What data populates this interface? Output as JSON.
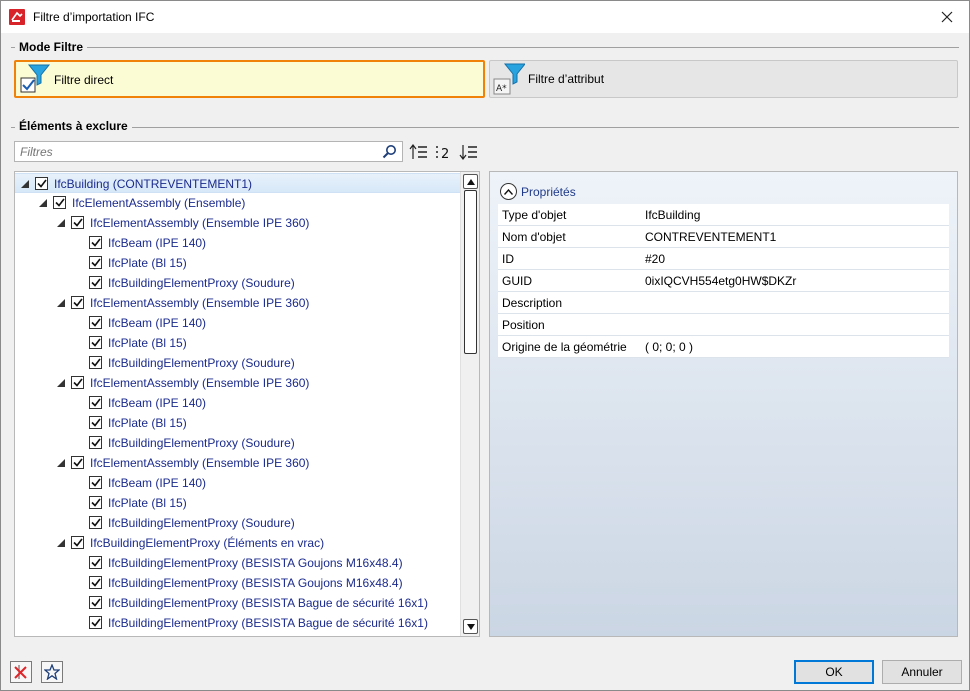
{
  "window": {
    "title": "Filtre d’importation IFC"
  },
  "mode_filter": {
    "heading": "Mode Filtre",
    "direct_label": "Filtre direct",
    "attribute_label": "Filtre d’attribut",
    "active": "direct"
  },
  "exclude": {
    "heading": "Éléments à exclure",
    "filter_placeholder": "Filtres",
    "filter_value": ""
  },
  "tree": [
    {
      "label": "IfcBuilding (CONTREVENTEMENT1)",
      "level": 0,
      "expandable": true,
      "checked": true,
      "selected": true
    },
    {
      "label": "IfcElementAssembly (Ensemble)",
      "level": 1,
      "expandable": true,
      "checked": true
    },
    {
      "label": "IfcElementAssembly (Ensemble IPE 360)",
      "level": 2,
      "expandable": true,
      "checked": true
    },
    {
      "label": "IfcBeam (IPE 140)",
      "level": 3,
      "expandable": false,
      "checked": true
    },
    {
      "label": "IfcPlate (Bl 15)",
      "level": 3,
      "expandable": false,
      "checked": true
    },
    {
      "label": "IfcBuildingElementProxy (Soudure)",
      "level": 3,
      "expandable": false,
      "checked": true
    },
    {
      "label": "IfcElementAssembly (Ensemble IPE 360)",
      "level": 2,
      "expandable": true,
      "checked": true
    },
    {
      "label": "IfcBeam (IPE 140)",
      "level": 3,
      "expandable": false,
      "checked": true
    },
    {
      "label": "IfcPlate (Bl 15)",
      "level": 3,
      "expandable": false,
      "checked": true
    },
    {
      "label": "IfcBuildingElementProxy (Soudure)",
      "level": 3,
      "expandable": false,
      "checked": true
    },
    {
      "label": "IfcElementAssembly (Ensemble IPE 360)",
      "level": 2,
      "expandable": true,
      "checked": true
    },
    {
      "label": "IfcBeam (IPE 140)",
      "level": 3,
      "expandable": false,
      "checked": true
    },
    {
      "label": "IfcPlate (Bl 15)",
      "level": 3,
      "expandable": false,
      "checked": true
    },
    {
      "label": "IfcBuildingElementProxy (Soudure)",
      "level": 3,
      "expandable": false,
      "checked": true
    },
    {
      "label": "IfcElementAssembly (Ensemble IPE 360)",
      "level": 2,
      "expandable": true,
      "checked": true
    },
    {
      "label": "IfcBeam (IPE 140)",
      "level": 3,
      "expandable": false,
      "checked": true
    },
    {
      "label": "IfcPlate (Bl 15)",
      "level": 3,
      "expandable": false,
      "checked": true
    },
    {
      "label": "IfcBuildingElementProxy (Soudure)",
      "level": 3,
      "expandable": false,
      "checked": true
    },
    {
      "label": "IfcBuildingElementProxy (Éléments en vrac)",
      "level": 2,
      "expandable": true,
      "checked": true
    },
    {
      "label": "IfcBuildingElementProxy (BESISTA Goujons M16x48.4)",
      "level": 3,
      "expandable": false,
      "checked": true
    },
    {
      "label": "IfcBuildingElementProxy (BESISTA Goujons M16x48.4)",
      "level": 3,
      "expandable": false,
      "checked": true
    },
    {
      "label": "IfcBuildingElementProxy (BESISTA Bague de sécurité 16x1)",
      "level": 3,
      "expandable": false,
      "checked": true
    },
    {
      "label": "IfcBuildingElementProxy (BESISTA Bague de sécurité 16x1)",
      "level": 3,
      "expandable": false,
      "checked": true
    }
  ],
  "properties": {
    "heading": "Propriétés",
    "rows": [
      {
        "key": "Type d'objet",
        "value": "IfcBuilding"
      },
      {
        "key": "Nom d'objet",
        "value": "CONTREVENTEMENT1"
      },
      {
        "key": "ID",
        "value": "#20"
      },
      {
        "key": "GUID",
        "value": "0ixIQCVH554etg0HW$DKZr"
      },
      {
        "key": "Description",
        "value": ""
      },
      {
        "key": "Position",
        "value": ""
      },
      {
        "key": "Origine de la géométrie",
        "value": "( 0; 0; 0 )"
      }
    ]
  },
  "buttons": {
    "ok": "OK",
    "cancel": "Annuler"
  },
  "colors": {
    "accent": "#f0820a",
    "active_bg": "#fbfbd4",
    "tree_text": "#1b2b8c",
    "ok_border": "#0078d7"
  }
}
